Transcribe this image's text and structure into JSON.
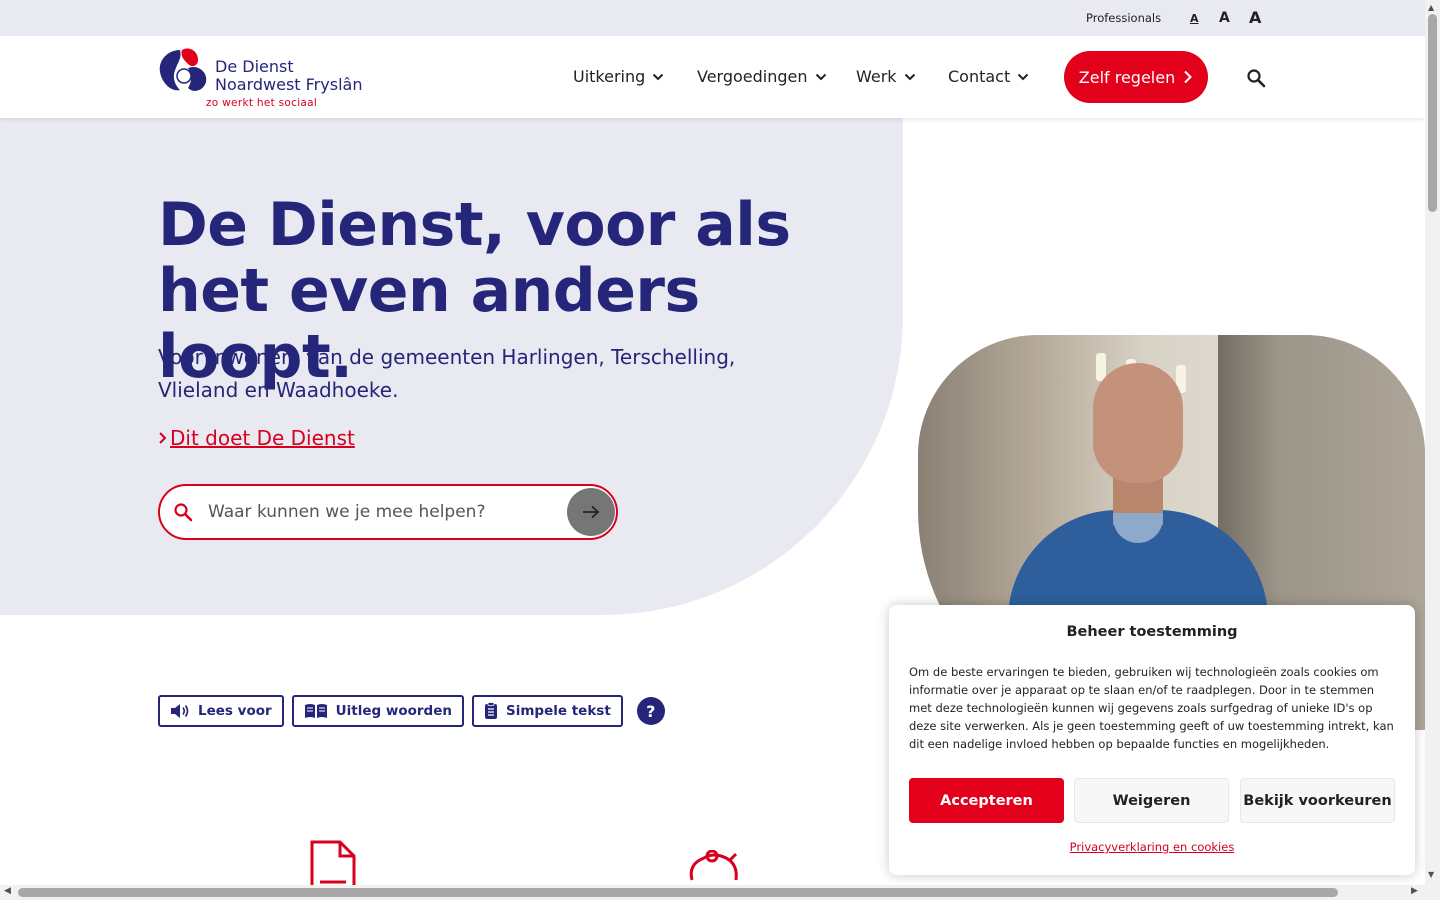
{
  "topbar": {
    "professionals": "Professionals",
    "font_small": "A",
    "font_medium": "A",
    "font_large": "A"
  },
  "logo": {
    "line1": "De Dienst",
    "line2": "Noardwest Fryslân",
    "tagline": "zo werkt het sociaal"
  },
  "nav": {
    "items": [
      {
        "label": "Uitkering"
      },
      {
        "label": "Vergoedingen"
      },
      {
        "label": "Werk"
      },
      {
        "label": "Contact"
      }
    ],
    "cta": "Zelf regelen",
    "search_icon": "search-icon"
  },
  "hero": {
    "title": "De Dienst, voor als het even anders loopt.",
    "subtitle": "Voor inwoners van de gemeenten Harlingen, Terschelling, Vlieland en Waadhoeke.",
    "link": "Dit doet De Dienst",
    "search_placeholder": "Waar kunnen we je mee helpen?"
  },
  "tools": {
    "read_aloud": "Lees voor",
    "explain_words": "Uitleg woorden",
    "simple_text": "Simpele tekst",
    "help": "?"
  },
  "cookie": {
    "title": "Beheer toestemming",
    "body": "Om de beste ervaringen te bieden, gebruiken wij technologieën zoals cookies om informatie over je apparaat op te slaan en/of te raadplegen. Door in te stemmen met deze technologieën kunnen wij gegevens zoals surfgedrag of unieke ID's op deze site verwerken. Als je geen toestemming geeft of uw toestemming intrekt, kan dit een nadelige invloed hebben op bepaalde functies en mogelijkheden.",
    "accept": "Accepteren",
    "deny": "Weigeren",
    "preferences": "Bekijk voorkeuren",
    "privacy_link": "Privacyverklaring en cookies"
  },
  "colors": {
    "brand_navy": "#25267a",
    "brand_red": "#e3001b",
    "hero_bg": "#e9e9f2"
  }
}
